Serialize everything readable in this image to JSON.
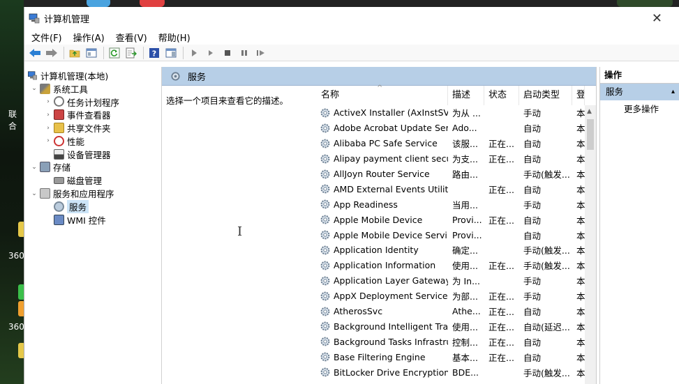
{
  "desktop": {
    "labels": [
      "联合",
      "360",
      "360"
    ]
  },
  "window": {
    "title": "计算机管理",
    "close": "✕"
  },
  "menu": [
    "文件(F)",
    "操作(A)",
    "查看(V)",
    "帮助(H)"
  ],
  "tree": {
    "root": "计算机管理(本地)",
    "items": [
      {
        "label": "系统工具",
        "level": 1,
        "expander": "⌄"
      },
      {
        "label": "任务计划程序",
        "level": 2,
        "expander": "›"
      },
      {
        "label": "事件查看器",
        "level": 2,
        "expander": "›"
      },
      {
        "label": "共享文件夹",
        "level": 2,
        "expander": "›"
      },
      {
        "label": "性能",
        "level": 2,
        "expander": "›"
      },
      {
        "label": "设备管理器",
        "level": 2,
        "expander": ""
      },
      {
        "label": "存储",
        "level": 1,
        "expander": "⌄"
      },
      {
        "label": "磁盘管理",
        "level": 2,
        "expander": ""
      },
      {
        "label": "服务和应用程序",
        "level": 1,
        "expander": "⌄"
      },
      {
        "label": "服务",
        "level": 2,
        "expander": ""
      },
      {
        "label": "WMI 控件",
        "level": 2,
        "expander": ""
      }
    ]
  },
  "main": {
    "header": "服务",
    "description": "选择一个项目来查看它的描述。",
    "cursor": "I",
    "columns": {
      "name": "名称",
      "desc": "描述",
      "status": "状态",
      "type": "启动类型",
      "login": "登"
    },
    "sort_caret": "^",
    "rows": [
      {
        "name": "ActiveX Installer (AxInstSV)",
        "desc": "为从 ...",
        "status": "",
        "type": "手动",
        "login": "本"
      },
      {
        "name": "Adobe Acrobat Update Ser...",
        "desc": "Ado...",
        "status": "",
        "type": "自动",
        "login": "本"
      },
      {
        "name": "Alibaba PC Safe Service",
        "desc": "该服...",
        "status": "正在...",
        "type": "自动",
        "login": "本"
      },
      {
        "name": "Alipay payment client secu...",
        "desc": "为支...",
        "status": "正在...",
        "type": "自动",
        "login": "本"
      },
      {
        "name": "AllJoyn Router Service",
        "desc": "路由...",
        "status": "",
        "type": "手动(触发...",
        "login": "本"
      },
      {
        "name": "AMD External Events Utility",
        "desc": "",
        "status": "正在...",
        "type": "自动",
        "login": "本"
      },
      {
        "name": "App Readiness",
        "desc": "当用...",
        "status": "",
        "type": "手动",
        "login": "本"
      },
      {
        "name": "Apple Mobile Device",
        "desc": "Provi...",
        "status": "正在...",
        "type": "自动",
        "login": "本"
      },
      {
        "name": "Apple Mobile Device Servi...",
        "desc": "Provi...",
        "status": "",
        "type": "自动",
        "login": "本"
      },
      {
        "name": "Application Identity",
        "desc": "确定...",
        "status": "",
        "type": "手动(触发...",
        "login": "本"
      },
      {
        "name": "Application Information",
        "desc": "使用...",
        "status": "正在...",
        "type": "手动(触发...",
        "login": "本"
      },
      {
        "name": "Application Layer Gateway ...",
        "desc": "为 In...",
        "status": "",
        "type": "手动",
        "login": "本"
      },
      {
        "name": "AppX Deployment Service ...",
        "desc": "为部...",
        "status": "正在...",
        "type": "手动",
        "login": "本"
      },
      {
        "name": "AtherosSvc",
        "desc": "Athe...",
        "status": "正在...",
        "type": "自动",
        "login": "本"
      },
      {
        "name": "Background Intelligent Tra...",
        "desc": "使用...",
        "status": "正在...",
        "type": "自动(延迟...",
        "login": "本"
      },
      {
        "name": "Background Tasks Infrastru...",
        "desc": "控制...",
        "status": "正在...",
        "type": "自动",
        "login": "本"
      },
      {
        "name": "Base Filtering Engine",
        "desc": "基本...",
        "status": "正在...",
        "type": "自动",
        "login": "本"
      },
      {
        "name": "BitLocker Drive Encryption ...",
        "desc": "BDE...",
        "status": "",
        "type": "手动(触发...",
        "login": "本"
      }
    ]
  },
  "actions": {
    "header": "操作",
    "selected": "服务",
    "selected_arrow": "▴",
    "more": "更多操作"
  },
  "colors": {
    "pane_header": "#b7cfe7",
    "selection": "#cce4f7"
  }
}
